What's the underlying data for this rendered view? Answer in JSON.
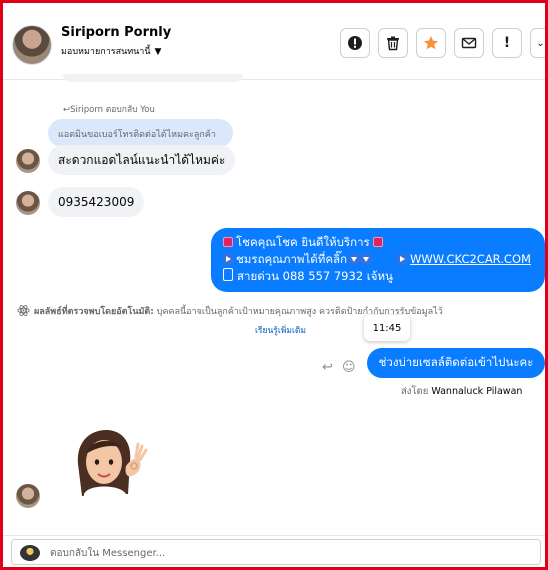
{
  "header": {
    "contact_name": "Siriporn Pornly",
    "assign_label": "มอบหมายการสนทนานี้",
    "buttons": [
      {
        "name": "mark-spam-button",
        "icon": "exclamation-circle-icon"
      },
      {
        "name": "delete-button",
        "icon": "trash-icon"
      },
      {
        "name": "star-button",
        "icon": "star-icon",
        "color": "#f7923b"
      },
      {
        "name": "mark-unread-button",
        "icon": "envelope-icon"
      },
      {
        "name": "report-button",
        "icon": "exclamation-icon"
      },
      {
        "name": "more-button",
        "icon": "chevron-down-icon"
      }
    ]
  },
  "conversation": {
    "reply_note": "Siriporn ตอบกลับ You",
    "quoted_text": "แอดมินขอเบอร์โทรติดต่อได้ไหมคะลูกค้า",
    "incoming_1": "สะดวกแอดไลน์แนะนำได้ไหมค่ะ",
    "incoming_2": "0935423009",
    "outgoing_big": {
      "line1": "โชคคุณโชค ยินดีให้บริการ",
      "line2_a": "ชมรถคุณภาพได้ที่คลิ๊ก",
      "line2_url": "WWW.CKC2CAR.COM",
      "line3": "สายด่วน 088 557 7932 เจ้หนู"
    },
    "auto_detect_title": "ผลลัพธ์ที่ตรวจพบโดยอัตโนมัติ:",
    "auto_detect_text": "บุคคลนี้อาจเป็นลูกค้าเป้าหมายคุณภาพสูง ควรติดป้ายกำกับการรับข้อมูลไว้",
    "learn_more": "เรียนรู้เพิ่มเติม",
    "tooltip_time": "11:45",
    "outgoing_small": "ช่วงบ่ายเซลล์ติดต่อเข้าไปนะคะ",
    "sent_by_label": "ส่งโดย",
    "sent_by_name": "Wannaluck Pilawan"
  },
  "composer": {
    "placeholder": "ตอบกลับใน Messenger..."
  },
  "colors": {
    "accent_blue": "#0a7cff",
    "frame_red": "#e0001b",
    "incoming_bubble": "#f0f2f5",
    "quoted_bubble": "#dbe8fb"
  }
}
